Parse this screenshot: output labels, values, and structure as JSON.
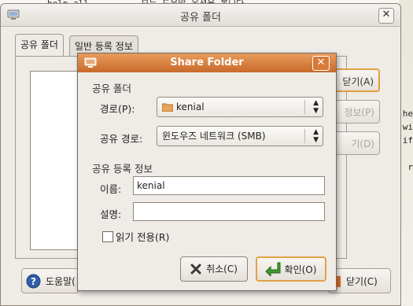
{
  "background": {
    "terminal_line": "help all          모든 도움말 옵션을 봅니다",
    "side_fragments": [
      "he",
      "wi",
      "if",
      "r"
    ]
  },
  "main_window": {
    "title": "공유 폴더",
    "tabs": [
      {
        "label": "공유 폴더",
        "active": true
      },
      {
        "label": "일반 등록 정보",
        "active": false
      }
    ],
    "side_buttons": [
      {
        "label": "닫기(A)",
        "state": "focused"
      },
      {
        "label": "정보(P)",
        "state": "disabled"
      },
      {
        "label": "기(D)",
        "state": "disabled"
      }
    ],
    "help_button": "도움말(",
    "close_button": "닫기(C)"
  },
  "share_dialog": {
    "title": "Share Folder",
    "section_folder": "공유 폴더",
    "path_label": "경로(P):",
    "path_value": "kenial",
    "share_path_label": "공유 경로:",
    "share_path_value": "윈도우즈 네트워크 (SMB)",
    "section_info": "공유 등록 정보",
    "name_label": "이름:",
    "name_value": "kenial",
    "desc_label": "설명:",
    "desc_value": "",
    "readonly_label": "읽기 전용(R)",
    "readonly_checked": false,
    "cancel_label": "취소(C)",
    "ok_label": "확인(O)"
  },
  "colors": {
    "accent_orange": "#d97a38",
    "focus_ring": "#e2a040",
    "ok_green": "#3f9a2c",
    "help_blue": "#2f5fa8"
  }
}
